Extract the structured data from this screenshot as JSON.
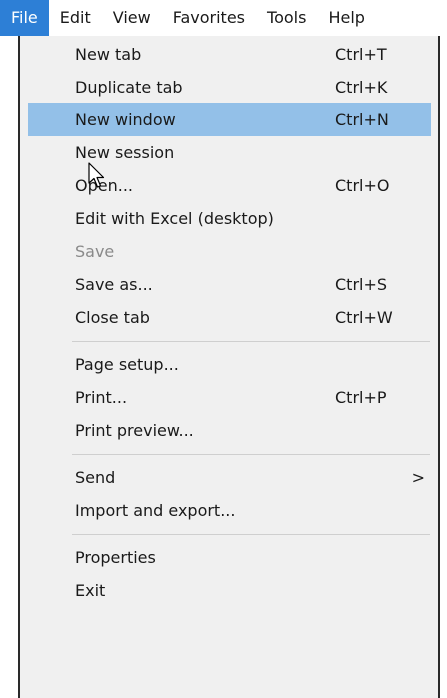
{
  "menubar": {
    "items": [
      {
        "label": "File",
        "active": true
      },
      {
        "label": "Edit"
      },
      {
        "label": "View"
      },
      {
        "label": "Favorites"
      },
      {
        "label": "Tools"
      },
      {
        "label": "Help"
      }
    ]
  },
  "file_menu": {
    "items": [
      {
        "label": "New tab",
        "shortcut": "Ctrl+T"
      },
      {
        "label": "Duplicate tab",
        "shortcut": "Ctrl+K"
      },
      {
        "label": "New window",
        "shortcut": "Ctrl+N",
        "state": "highlighted"
      },
      {
        "label": "New session",
        "shortcut": ""
      },
      {
        "label": "Open...",
        "shortcut": "Ctrl+O"
      },
      {
        "label": "Edit with Excel (desktop)",
        "shortcut": ""
      },
      {
        "label": "Save",
        "shortcut": "",
        "state": "disabled"
      },
      {
        "label": "Save as...",
        "shortcut": "Ctrl+S"
      },
      {
        "label": "Close tab",
        "shortcut": "Ctrl+W"
      },
      {
        "label": "Page setup...",
        "shortcut": ""
      },
      {
        "label": "Print...",
        "shortcut": "Ctrl+P"
      },
      {
        "label": "Print preview...",
        "shortcut": ""
      },
      {
        "label": "Send",
        "shortcut": "",
        "submenu_arrow": ">"
      },
      {
        "label": "Import and export...",
        "shortcut": ""
      },
      {
        "label": "Properties",
        "shortcut": ""
      },
      {
        "label": "Exit",
        "shortcut": ""
      }
    ]
  },
  "colors": {
    "active_menubar_bg": "#2d7fd6",
    "highlight_bg": "#93c0e8",
    "menu_bg": "#f0f0f0",
    "disabled_text": "#8a8a8a"
  },
  "icons": {
    "cursor": "arrow-cursor-icon",
    "submenu": "chevron-right-icon"
  }
}
